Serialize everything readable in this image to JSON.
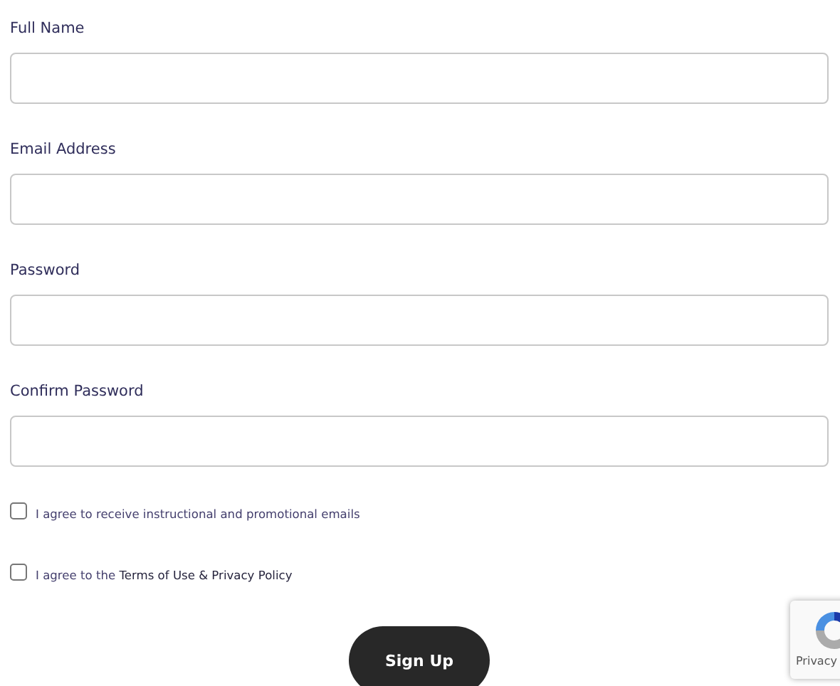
{
  "fields": [
    {
      "label": "Full Name"
    },
    {
      "label": "Email Address"
    },
    {
      "label": "Password"
    },
    {
      "label": "Confirm Password"
    }
  ],
  "checkboxes": [
    {
      "label": "I agree to receive instructional and promotional emails",
      "checked": false
    },
    {
      "label": "I agree to the",
      "link": "Terms of Use & Privacy Policy",
      "checked": false
    }
  ],
  "submit": "Sign Up",
  "recaptcha": {
    "text": "Privacy"
  }
}
